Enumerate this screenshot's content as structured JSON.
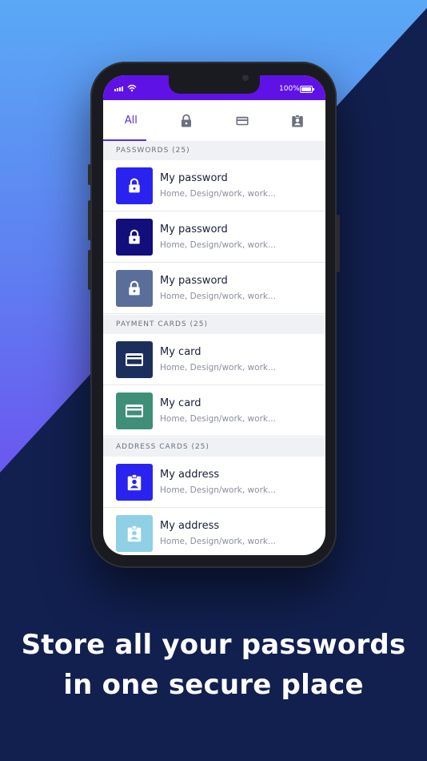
{
  "status_bar": {
    "battery": "100%"
  },
  "tabs": [
    {
      "label": "All",
      "active": true
    },
    {
      "icon": "lock-icon"
    },
    {
      "icon": "credit-card-icon"
    },
    {
      "icon": "address-card-icon"
    }
  ],
  "sections": {
    "passwords": "PASSWORDS (25)",
    "payment_cards": "PAYMENT CARDS (25)",
    "address_cards": "ADDRESS CARDS (25)"
  },
  "items": [
    {
      "title": "My password",
      "subtitle": "Home, Design/work, work...",
      "icon": "lock-icon",
      "color": "#2a23f0"
    },
    {
      "title": "My password",
      "subtitle": "Home, Design/work, work...",
      "icon": "lock-icon",
      "color": "#120e7c"
    },
    {
      "title": "My password",
      "subtitle": "Home, Design/work, work...",
      "icon": "lock-icon",
      "color": "#5a6e9c"
    },
    {
      "title": "My card",
      "subtitle": "Home, Design/work, work...",
      "icon": "credit-card-icon",
      "color": "#1c2e5c"
    },
    {
      "title": "My card",
      "subtitle": "Home, Design/work, work...",
      "icon": "credit-card-icon",
      "color": "#3f8f78"
    },
    {
      "title": "My address",
      "subtitle": "Home, Design/work, work...",
      "icon": "address-card-icon",
      "color": "#2a23f0"
    },
    {
      "title": "My address",
      "subtitle": "Home, Design/work, work...",
      "icon": "address-card-icon",
      "color": "#8fd0e4"
    }
  ],
  "headline": {
    "line1": "Store all your passwords",
    "line2": "in one secure place"
  },
  "colors": {
    "accent": "#5b2ee0",
    "status_bar": "#5f12e6",
    "background_dark": "#122050"
  }
}
